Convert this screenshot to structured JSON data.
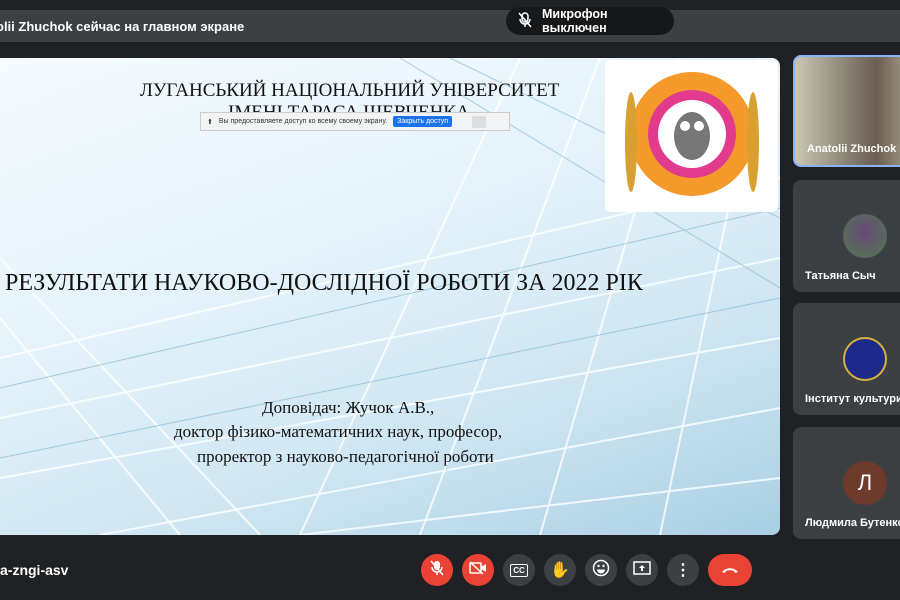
{
  "banner": {
    "presenting_text": "olii Zhuchok сейчас на главном экране"
  },
  "toast": {
    "mic_off": "Микрофон выключен"
  },
  "slide": {
    "university_line1": "ЛУГАНСЬКИЙ НАЦІОНАЛЬНИЙ УНІВЕРСИТЕТ",
    "university_line2": "ІМЕНІ ТАРАСА ШЕВЧЕНКА",
    "title": "РЕЗУЛЬТАТИ НАУКОВО-ДОСЛІДНОЇ РОБОТИ ЗА 2022 РІК",
    "speaker_line1": "Доповідач:  Жучок А.В.,",
    "speaker_line2": "доктор фізико-математичних  наук, професор,",
    "speaker_line3": "проректор з науково-педагогічної роботи"
  },
  "share_bar": {
    "message": "Вы предоставляете доступ ко всему своему экрану.",
    "stop_label": "Закрыть доступ"
  },
  "participants": [
    {
      "name": "Anatolii Zhuchok"
    },
    {
      "name": "Татьяна Сыч"
    },
    {
      "name": "Інститут культури"
    },
    {
      "name": "Людмила Бутенко",
      "initial": "Л"
    }
  ],
  "meeting": {
    "code": "a-zngi-asv"
  },
  "colors": {
    "red": "#ea4335",
    "dark": "#202124",
    "button": "#3c4043",
    "accent": "#8ab4f8"
  }
}
